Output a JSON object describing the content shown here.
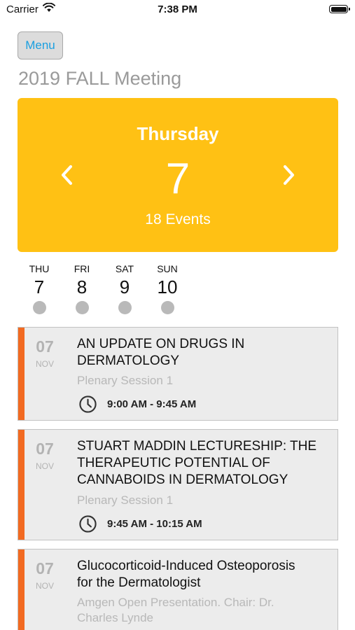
{
  "status_bar": {
    "carrier": "Carrier",
    "time": "7:38 PM"
  },
  "nav": {
    "menu_label": "Menu"
  },
  "page": {
    "title": "2019 FALL Meeting"
  },
  "hero": {
    "weekday": "Thursday",
    "date": "7",
    "event_count": "18 Events",
    "accent_color": "#ffc114"
  },
  "days": [
    {
      "name": "THU",
      "num": "7"
    },
    {
      "name": "FRI",
      "num": "8"
    },
    {
      "name": "SAT",
      "num": "9"
    },
    {
      "name": "SUN",
      "num": "10"
    }
  ],
  "events": [
    {
      "day": "07",
      "month": "NOV",
      "title_lines": [
        "AN UPDATE ON DRUGS IN",
        "DERMATOLOGY"
      ],
      "session_lines": [
        "Plenary Session 1"
      ],
      "time": "9:00 AM - 9:45 AM"
    },
    {
      "day": "07",
      "month": "NOV",
      "title_lines": [
        "STUART MADDIN LECTURESHIP: THE",
        "THERAPEUTIC POTENTIAL OF",
        "CANNABOIDS IN DERMATOLOGY"
      ],
      "session_lines": [
        "Plenary Session 1"
      ],
      "time": "9:45 AM - 10:15 AM"
    },
    {
      "day": "07",
      "month": "NOV",
      "title_lines": [
        "Glucocorticoid-Induced Osteoporosis",
        "for the Dermatologist"
      ],
      "session_lines": [
        "Amgen Open Presentation. Chair: Dr.",
        "Charles Lynde"
      ],
      "time": ""
    }
  ],
  "colors": {
    "stripe": "#f26a21",
    "link": "#1a9fe0"
  }
}
